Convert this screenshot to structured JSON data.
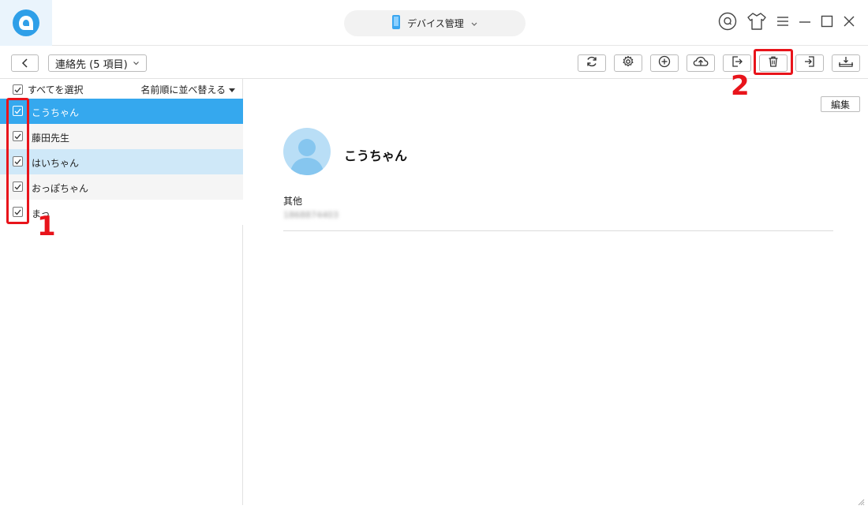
{
  "titlebar": {
    "device_label": "デバイス管理",
    "icons": [
      "search-icon",
      "skin-icon",
      "menu-icon",
      "minimize-icon",
      "maximize-icon",
      "close-icon"
    ]
  },
  "toolbar": {
    "section_label": "連絡先 (5 項目)",
    "tools": [
      "refresh-icon",
      "settings-icon",
      "add-icon",
      "upload-cloud-icon",
      "export-icon",
      "trash-icon",
      "import-icon",
      "download-icon"
    ]
  },
  "list": {
    "select_all_label": "すべてを選択",
    "sort_label": "名前順に並べ替える",
    "contacts": [
      {
        "name": "こうちゃん",
        "checked": true,
        "state": "active"
      },
      {
        "name": "藤田先生",
        "checked": true,
        "state": "normal"
      },
      {
        "name": "はいちゃん",
        "checked": true,
        "state": "hover"
      },
      {
        "name": "おっぽちゃん",
        "checked": true,
        "state": "normal"
      },
      {
        "name": "まっ",
        "checked": true,
        "state": "normal"
      }
    ]
  },
  "detail": {
    "edit_label": "編集",
    "contact_name": "こうちゃん",
    "field_label": "其他",
    "field_value": "1868874403"
  },
  "annotations": {
    "step1": "1",
    "step2": "2",
    "color": "#e8141b"
  },
  "colors": {
    "accent": "#35a8ee",
    "hover_row": "#cfe8f8",
    "stripe_row": "#f5f5f5"
  }
}
